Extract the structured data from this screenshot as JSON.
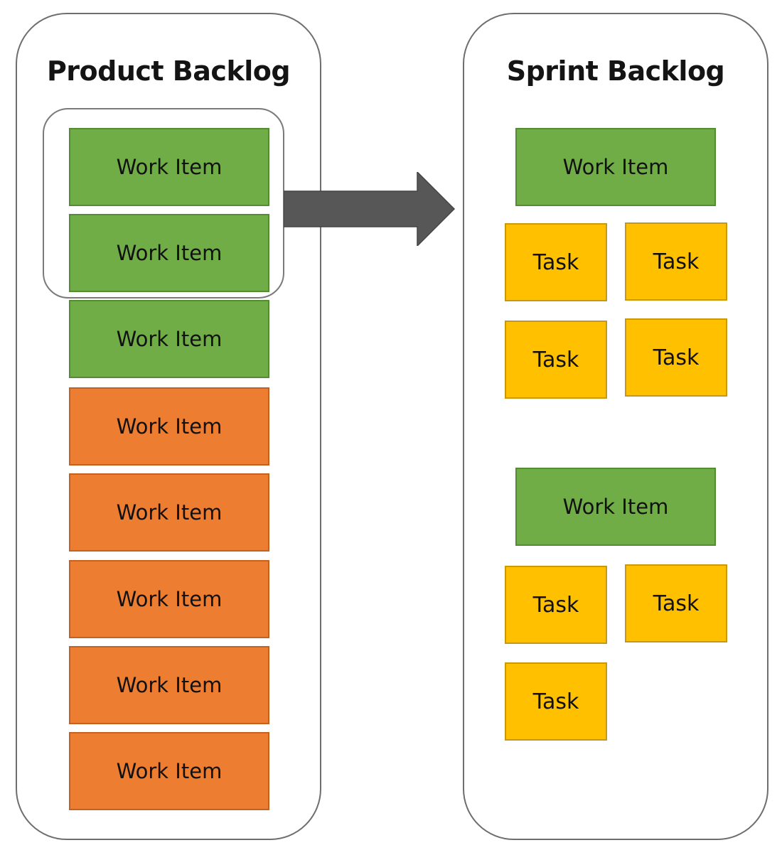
{
  "product_backlog": {
    "title": "Product Backlog",
    "items": [
      {
        "label": "Work Item",
        "status": "selected",
        "color": "#70ad47"
      },
      {
        "label": "Work Item",
        "status": "selected",
        "color": "#70ad47"
      },
      {
        "label": "Work Item",
        "status": "ready",
        "color": "#70ad47"
      },
      {
        "label": "Work Item",
        "status": "not-ready",
        "color": "#ed7d31"
      },
      {
        "label": "Work Item",
        "status": "not-ready",
        "color": "#ed7d31"
      },
      {
        "label": "Work Item",
        "status": "not-ready",
        "color": "#ed7d31"
      },
      {
        "label": "Work Item",
        "status": "not-ready",
        "color": "#ed7d31"
      },
      {
        "label": "Work Item",
        "status": "not-ready",
        "color": "#ed7d31"
      }
    ]
  },
  "arrow": {
    "icon": "right-arrow-icon",
    "color": "#575757"
  },
  "sprint_backlog": {
    "title": "Sprint Backlog",
    "groups": [
      {
        "work_item": "Work Item",
        "tasks": [
          "Task",
          "Task",
          "Task",
          "Task"
        ]
      },
      {
        "work_item": "Work Item",
        "tasks": [
          "Task",
          "Task",
          "Task"
        ]
      }
    ]
  },
  "colors": {
    "work_item_ready": "#70ad47",
    "work_item_not_ready": "#ed7d31",
    "task": "#ffc000",
    "outline": "#6e6e6e"
  }
}
